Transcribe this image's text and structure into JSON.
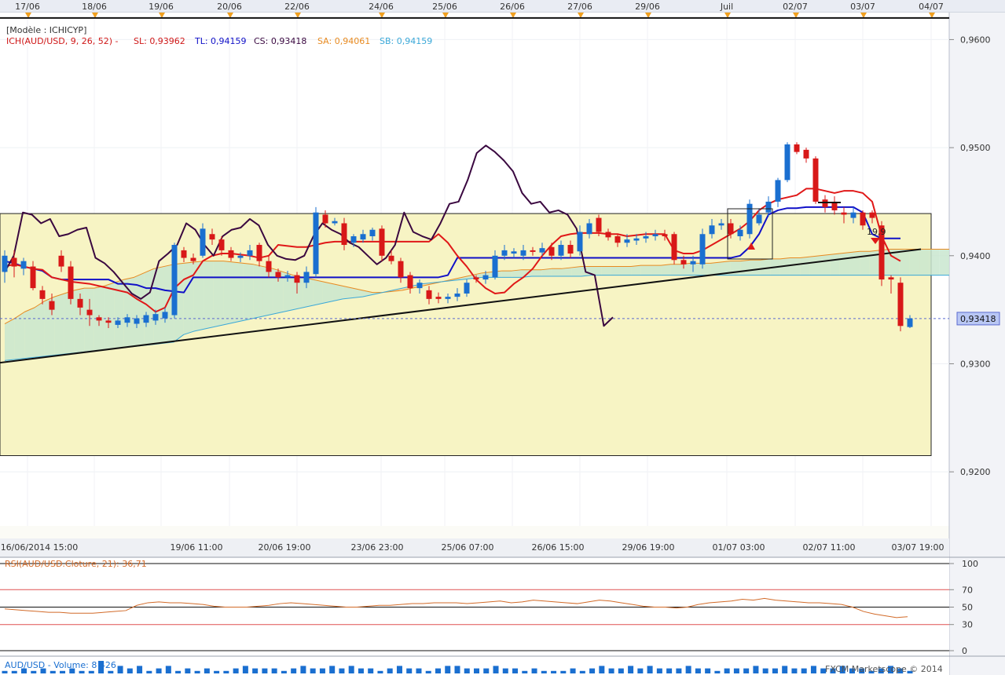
{
  "top_dates": [
    "17/06",
    "18/06",
    "19/06",
    "20/06",
    "22/06",
    "24/06",
    "25/06",
    "26/06",
    "27/06",
    "29/06",
    "Juil",
    "02/07",
    "03/07",
    "04/07"
  ],
  "bottom_dates": [
    "16/06/2014 15:00",
    "19/06 11:00",
    "20/06 19:00",
    "23/06 23:00",
    "25/06 07:00",
    "26/06 15:00",
    "29/06 19:00",
    "01/07 03:00",
    "02/07 11:00",
    "03/07 19:00"
  ],
  "legend": {
    "model": "[Modèle : ICHICYP]",
    "ich": "ICH(AUD/USD, 9, 26, 52) -",
    "sl": "SL: 0,93962",
    "tl": "TL: 0,94159",
    "cs": "CS: 0,93418",
    "sa": "SA: 0,94061",
    "sb": "SB: 0,94159"
  },
  "price_badge": "0,93418",
  "annotation": "19,9",
  "rsi": {
    "label": "RSI(AUD/USD.Cloture, 21): 36,71",
    "ticks": [
      "100",
      "70",
      "50",
      "30",
      "0"
    ]
  },
  "volume": {
    "label": "AUD/USD - Volume: 8 426"
  },
  "watermark": "FXCM Marketscope © 2014",
  "colors": {
    "sl": "#e01818",
    "tl": "#1010c8",
    "cs": "#3a0840",
    "sa": "#e88a20",
    "sb": "#3aa8d8",
    "bull": "#1a6fd0",
    "bear": "#d81818",
    "zone": "#f7f4c4",
    "cloud_bull": "#c9e6cf",
    "cloud_bear": "#f2d9a8",
    "rsi": "#d26a28",
    "badge": "#b9c7f4"
  },
  "chart_data": {
    "type": "candlestick",
    "instrument": "AUD/USD",
    "y_ticks": [
      "0,9600",
      "0,9500",
      "0,9400",
      "0,9300",
      "0,9200"
    ],
    "ylim": [
      0.915,
      0.9625
    ],
    "levels": {
      "resistance": 0.962,
      "current": 0.93418,
      "range_top": 0.9439,
      "range_bottom": 0.9215
    },
    "candles": [
      [
        0.9385,
        0.94,
        0.9405,
        0.9375
      ],
      [
        0.9398,
        0.939,
        0.9405,
        0.938
      ],
      [
        0.9388,
        0.9395,
        0.9398,
        0.9382
      ],
      [
        0.939,
        0.937,
        0.9395,
        0.9368
      ],
      [
        0.9368,
        0.936,
        0.9372,
        0.9355
      ],
      [
        0.9358,
        0.935,
        0.9365,
        0.9345
      ],
      [
        0.94,
        0.939,
        0.9405,
        0.9385
      ],
      [
        0.939,
        0.936,
        0.9395,
        0.9355
      ],
      [
        0.936,
        0.9352,
        0.9365,
        0.9345
      ],
      [
        0.935,
        0.9345,
        0.936,
        0.9335
      ],
      [
        0.9343,
        0.934,
        0.9345,
        0.9335
      ],
      [
        0.934,
        0.9338,
        0.9343,
        0.9333
      ],
      [
        0.9336,
        0.934,
        0.9343,
        0.9333
      ],
      [
        0.9338,
        0.9343,
        0.9346,
        0.9334
      ],
      [
        0.9337,
        0.9342,
        0.9345,
        0.9333
      ],
      [
        0.9338,
        0.9345,
        0.9348,
        0.9334
      ],
      [
        0.934,
        0.9346,
        0.935,
        0.9336
      ],
      [
        0.9342,
        0.9348,
        0.9352,
        0.9338
      ],
      [
        0.9345,
        0.941,
        0.9412,
        0.9342
      ],
      [
        0.9405,
        0.9398,
        0.9408,
        0.9394
      ],
      [
        0.9398,
        0.9395,
        0.9402,
        0.9392
      ],
      [
        0.94,
        0.9425,
        0.943,
        0.9398
      ],
      [
        0.942,
        0.9415,
        0.9425,
        0.941
      ],
      [
        0.9415,
        0.9405,
        0.9418,
        0.94
      ],
      [
        0.9405,
        0.9398,
        0.9408,
        0.9395
      ],
      [
        0.9398,
        0.94,
        0.9403,
        0.9394
      ],
      [
        0.94,
        0.9405,
        0.941,
        0.9396
      ],
      [
        0.941,
        0.9395,
        0.9412,
        0.939
      ],
      [
        0.9395,
        0.9385,
        0.94,
        0.938
      ],
      [
        0.9385,
        0.938,
        0.9388,
        0.9376
      ],
      [
        0.938,
        0.9382,
        0.9386,
        0.9376
      ],
      [
        0.9382,
        0.9375,
        0.9385,
        0.9365
      ],
      [
        0.9375,
        0.9385,
        0.939,
        0.937
      ],
      [
        0.9383,
        0.944,
        0.9445,
        0.938
      ],
      [
        0.9438,
        0.943,
        0.9442,
        0.9426
      ],
      [
        0.943,
        0.9432,
        0.9435,
        0.9428
      ],
      [
        0.943,
        0.941,
        0.9435,
        0.9405
      ],
      [
        0.9412,
        0.9418,
        0.942,
        0.9408
      ],
      [
        0.9415,
        0.942,
        0.9424,
        0.9412
      ],
      [
        0.9418,
        0.9424,
        0.9426,
        0.9414
      ],
      [
        0.9425,
        0.94,
        0.9428,
        0.9395
      ],
      [
        0.94,
        0.9395,
        0.9405,
        0.9392
      ],
      [
        0.9395,
        0.938,
        0.9398,
        0.9375
      ],
      [
        0.9382,
        0.937,
        0.9385,
        0.9365
      ],
      [
        0.937,
        0.9375,
        0.9378,
        0.9365
      ],
      [
        0.9368,
        0.936,
        0.9372,
        0.9355
      ],
      [
        0.9362,
        0.936,
        0.9366,
        0.9356
      ],
      [
        0.936,
        0.9362,
        0.9365,
        0.9356
      ],
      [
        0.9362,
        0.9365,
        0.937,
        0.9358
      ],
      [
        0.9365,
        0.9375,
        0.9378,
        0.9362
      ],
      [
        0.938,
        0.9378,
        0.9382,
        0.9375
      ],
      [
        0.9378,
        0.9382,
        0.9386,
        0.9374
      ],
      [
        0.938,
        0.94,
        0.9405,
        0.9378
      ],
      [
        0.94,
        0.9405,
        0.941,
        0.9396
      ],
      [
        0.9402,
        0.9404,
        0.9407,
        0.9398
      ],
      [
        0.94,
        0.9405,
        0.941,
        0.9396
      ],
      [
        0.9405,
        0.9404,
        0.9408,
        0.94
      ],
      [
        0.9403,
        0.9407,
        0.9412,
        0.94
      ],
      [
        0.9408,
        0.94,
        0.9412,
        0.9396
      ],
      [
        0.94,
        0.941,
        0.9414,
        0.9396
      ],
      [
        0.941,
        0.9402,
        0.9414,
        0.9398
      ],
      [
        0.9404,
        0.9422,
        0.9428,
        0.94
      ],
      [
        0.942,
        0.943,
        0.9434,
        0.9416
      ],
      [
        0.9435,
        0.9422,
        0.9438,
        0.9418
      ],
      [
        0.9422,
        0.9417,
        0.9425,
        0.9414
      ],
      [
        0.9418,
        0.9412,
        0.942,
        0.9408
      ],
      [
        0.9412,
        0.9415,
        0.942,
        0.9408
      ],
      [
        0.9414,
        0.9416,
        0.942,
        0.941
      ],
      [
        0.9416,
        0.9418,
        0.9422,
        0.9412
      ],
      [
        0.9418,
        0.942,
        0.9424,
        0.9414
      ],
      [
        0.942,
        0.9418,
        0.9424,
        0.9414
      ],
      [
        0.942,
        0.9396,
        0.9422,
        0.9392
      ],
      [
        0.9396,
        0.9392,
        0.94,
        0.9388
      ],
      [
        0.9392,
        0.9395,
        0.94,
        0.9385
      ],
      [
        0.9392,
        0.942,
        0.9425,
        0.9388
      ],
      [
        0.942,
        0.9428,
        0.9434,
        0.9416
      ],
      [
        0.9428,
        0.943,
        0.9434,
        0.9424
      ],
      [
        0.943,
        0.942,
        0.9434,
        0.9416
      ],
      [
        0.9418,
        0.9424,
        0.9428,
        0.9414
      ],
      [
        0.942,
        0.9448,
        0.9452,
        0.9416
      ],
      [
        0.943,
        0.9438,
        0.9444,
        0.9428
      ],
      [
        0.944,
        0.945,
        0.9455,
        0.9436
      ],
      [
        0.945,
        0.947,
        0.9472,
        0.9445
      ],
      [
        0.947,
        0.9503,
        0.9505,
        0.9468
      ],
      [
        0.9503,
        0.9496,
        0.9505,
        0.9494
      ],
      [
        0.9498,
        0.949,
        0.95,
        0.9486
      ],
      [
        0.949,
        0.945,
        0.9492,
        0.9448
      ],
      [
        0.9452,
        0.9445,
        0.9456,
        0.944
      ],
      [
        0.945,
        0.9442,
        0.9455,
        0.9438
      ],
      [
        0.944,
        0.9438,
        0.9445,
        0.943
      ],
      [
        0.9435,
        0.944,
        0.9445,
        0.943
      ],
      [
        0.944,
        0.9428,
        0.9442,
        0.9424
      ],
      [
        0.944,
        0.9435,
        0.9442,
        0.943
      ],
      [
        0.9428,
        0.9378,
        0.9432,
        0.9372
      ],
      [
        0.938,
        0.9378,
        0.9382,
        0.9365
      ],
      [
        0.9375,
        0.9335,
        0.938,
        0.933
      ],
      [
        0.9334,
        0.9342,
        0.9345,
        0.9333
      ]
    ],
    "tenkan": [
      0.939,
      0.9392,
      0.939,
      0.9388,
      0.9387,
      0.938,
      0.9378,
      0.9376,
      0.9375,
      0.9374,
      0.9372,
      0.937,
      0.9368,
      0.9366,
      0.936,
      0.9355,
      0.9348,
      0.9352,
      0.937,
      0.9378,
      0.9382,
      0.9395,
      0.94,
      0.9402,
      0.9402,
      0.9401,
      0.94,
      0.9398,
      0.94,
      0.941,
      0.9409,
      0.9408,
      0.9408,
      0.941,
      0.9412,
      0.9413,
      0.9413,
      0.9413,
      0.9413,
      0.9413,
      0.9413,
      0.9413,
      0.9413,
      0.9413,
      0.9413,
      0.9413,
      0.942,
      0.9412,
      0.94,
      0.939,
      0.9378,
      0.937,
      0.9365,
      0.9366,
      0.9374,
      0.938,
      0.9388,
      0.94,
      0.941,
      0.9418,
      0.942,
      0.9421,
      0.9421,
      0.9421,
      0.942,
      0.942,
      0.9418,
      0.9419,
      0.942,
      0.942,
      0.942,
      0.9405,
      0.9402,
      0.9402,
      0.9405,
      0.941,
      0.9415,
      0.942,
      0.9425,
      0.9432,
      0.9442,
      0.9448,
      0.9452,
      0.9454,
      0.9456,
      0.9462,
      0.9462,
      0.946,
      0.9458,
      0.946,
      0.946,
      0.9458,
      0.945,
      0.9418,
      0.94,
      0.9395
    ],
    "kijun": [
      0.9395,
      0.9393,
      0.939,
      0.9388,
      0.9386,
      0.938,
      0.9378,
      0.9378,
      0.9378,
      0.9378,
      0.9378,
      0.9378,
      0.9374,
      0.9374,
      0.9373,
      0.937,
      0.937,
      0.9368,
      0.9367,
      0.9366,
      0.938,
      0.938,
      0.938,
      0.938,
      0.938,
      0.938,
      0.938,
      0.938,
      0.938,
      0.938,
      0.938,
      0.938,
      0.938,
      0.938,
      0.938,
      0.938,
      0.938,
      0.938,
      0.938,
      0.938,
      0.938,
      0.938,
      0.938,
      0.938,
      0.938,
      0.938,
      0.938,
      0.9382,
      0.9398,
      0.9398,
      0.9398,
      0.9398,
      0.9398,
      0.9398,
      0.9398,
      0.9398,
      0.9398,
      0.9398,
      0.9398,
      0.9398,
      0.9398,
      0.9398,
      0.9398,
      0.9398,
      0.9398,
      0.9398,
      0.9398,
      0.9398,
      0.9398,
      0.9398,
      0.9398,
      0.9398,
      0.9398,
      0.9398,
      0.9398,
      0.9398,
      0.9398,
      0.9398,
      0.94,
      0.9408,
      0.942,
      0.9438,
      0.9442,
      0.9444,
      0.9444,
      0.9445,
      0.9445,
      0.9445,
      0.9445,
      0.9445,
      0.9445,
      0.944,
      0.942,
      0.9416,
      0.9416,
      0.9416
    ],
    "chikou": [
      0.9385,
      0.94,
      0.944,
      0.9438,
      0.943,
      0.9434,
      0.9418,
      0.942,
      0.9424,
      0.9426,
      0.9398,
      0.9393,
      0.9385,
      0.9375,
      0.9365,
      0.936,
      0.9366,
      0.9395,
      0.9402,
      0.941,
      0.943,
      0.9424,
      0.941,
      0.94,
      0.9418,
      0.9424,
      0.9426,
      0.9434,
      0.9428,
      0.941,
      0.94,
      0.9397,
      0.9396,
      0.94,
      0.9418,
      0.943,
      0.9424,
      0.942,
      0.9412,
      0.9408,
      0.94,
      0.9392,
      0.9398,
      0.941,
      0.944,
      0.9422,
      0.9418,
      0.9415,
      0.943,
      0.9448,
      0.945,
      0.947,
      0.9495,
      0.9502,
      0.9496,
      0.9488,
      0.9478,
      0.9458,
      0.9448,
      0.945,
      0.944,
      0.9442,
      0.9438,
      0.9425,
      0.9385,
      0.9382,
      0.9335,
      0.9343
    ],
    "senkou_a": [
      0.9337,
      0.9342,
      0.9348,
      0.9352,
      0.9358,
      0.9362,
      0.9365,
      0.9368,
      0.937,
      0.937,
      0.9372,
      0.9375,
      0.9378,
      0.938,
      0.9384,
      0.9388,
      0.939,
      0.9392,
      0.9393,
      0.9394,
      0.9395,
      0.9395,
      0.9395,
      0.9394,
      0.9393,
      0.9392,
      0.939,
      0.9388,
      0.9385,
      0.9382,
      0.938,
      0.9378,
      0.9376,
      0.9374,
      0.9372,
      0.937,
      0.9368,
      0.9366,
      0.9366,
      0.9367,
      0.9368,
      0.937,
      0.9372,
      0.9374,
      0.9376,
      0.9378,
      0.938,
      0.9382,
      0.9384,
      0.9385,
      0.9386,
      0.9386,
      0.9387,
      0.9387,
      0.9387,
      0.9388,
      0.9388,
      0.9389,
      0.939,
      0.939,
      0.939,
      0.939,
      0.939,
      0.939,
      0.9391,
      0.9391,
      0.9391,
      0.9392,
      0.9392,
      0.9393,
      0.9393,
      0.9393,
      0.9394,
      0.9395,
      0.9395,
      0.9396,
      0.9396,
      0.9397,
      0.9397,
      0.9398,
      0.9398,
      0.9399,
      0.94,
      0.9401,
      0.9402,
      0.9403,
      0.9404,
      0.9404,
      0.9405,
      0.9406,
      0.9406,
      0.9406,
      0.9406,
      0.9406,
      0.9406,
      0.9406
    ],
    "senkou_b": [
      0.9303,
      0.9304,
      0.9305,
      0.9306,
      0.9307,
      0.9308,
      0.9309,
      0.931,
      0.9311,
      0.9312,
      0.9313,
      0.9314,
      0.9315,
      0.9316,
      0.9317,
      0.9318,
      0.9319,
      0.932,
      0.9327,
      0.933,
      0.9332,
      0.9334,
      0.9336,
      0.9338,
      0.934,
      0.9342,
      0.9344,
      0.9346,
      0.9348,
      0.935,
      0.9352,
      0.9354,
      0.9356,
      0.9358,
      0.936,
      0.9361,
      0.9362,
      0.9364,
      0.9366,
      0.9368,
      0.937,
      0.9372,
      0.9374,
      0.9375,
      0.9376,
      0.9377,
      0.9378,
      0.9379,
      0.938,
      0.938,
      0.938,
      0.938,
      0.938,
      0.9381,
      0.9381,
      0.9381,
      0.9381,
      0.9381,
      0.9381,
      0.9382,
      0.9382,
      0.9382,
      0.9382,
      0.9382,
      0.9382,
      0.9382,
      0.9382,
      0.9382,
      0.9382,
      0.9382,
      0.9382,
      0.9382,
      0.9382,
      0.9382,
      0.9382,
      0.9382,
      0.9382,
      0.9382,
      0.9382,
      0.9382,
      0.9382,
      0.9382,
      0.9382,
      0.9382,
      0.9382,
      0.9382,
      0.9382,
      0.9382,
      0.9382,
      0.9382,
      0.9382,
      0.9382,
      0.9382,
      0.9382,
      0.9382,
      0.9382
    ],
    "trendline": {
      "start": 0.9301,
      "end": 0.9406
    },
    "rsi_values": [
      48,
      47,
      46,
      45,
      44,
      44,
      43,
      43,
      43,
      44,
      45,
      46,
      52,
      55,
      56,
      55,
      55,
      54,
      53,
      51,
      50,
      50,
      50,
      51,
      52,
      54,
      55,
      54,
      53,
      52,
      51,
      50,
      50,
      51,
      52,
      52,
      53,
      54,
      54,
      55,
      55,
      55,
      54,
      55,
      56,
      57,
      55,
      56,
      58,
      57,
      56,
      55,
      54,
      56,
      58,
      57,
      55,
      53,
      51,
      50,
      50,
      49,
      50,
      53,
      55,
      56,
      57,
      59,
      58,
      60,
      58,
      57,
      56,
      55,
      55,
      54,
      53,
      50,
      45,
      42,
      40,
      38,
      39
    ],
    "volume_values": [
      1,
      1,
      2,
      1,
      2,
      1,
      1,
      2,
      1,
      1,
      5,
      1,
      3,
      2,
      3,
      1,
      2,
      3,
      1,
      2,
      1,
      2,
      1,
      1,
      2,
      3,
      2,
      2,
      2,
      1,
      2,
      3,
      2,
      2,
      3,
      2,
      3,
      2,
      2,
      1,
      2,
      3,
      2,
      2,
      1,
      2,
      3,
      3,
      2,
      2,
      2,
      3,
      2,
      2,
      1,
      2,
      1,
      1,
      1,
      2,
      1,
      2,
      3,
      2,
      2,
      3,
      2,
      3,
      2,
      2,
      2,
      3,
      2,
      2,
      1,
      2,
      2,
      2,
      3,
      2,
      2,
      3,
      2,
      2,
      3,
      2,
      2,
      3,
      2,
      2,
      1,
      2,
      3,
      2,
      1
    ]
  }
}
